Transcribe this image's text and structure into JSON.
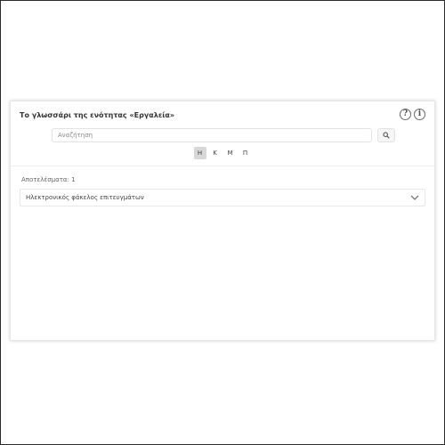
{
  "glossary": {
    "title": "Το γλωσσάρι της ενότητας «Εργαλεία»",
    "help_icon": "question-circle-icon",
    "info_icon": "info-circle-icon",
    "search": {
      "placeholder": "Αναζήτηση",
      "value": "",
      "button_icon": "search-icon"
    },
    "letters": [
      {
        "label": "Η",
        "active": true
      },
      {
        "label": "Κ",
        "active": false
      },
      {
        "label": "Μ",
        "active": false
      },
      {
        "label": "Π",
        "active": false
      }
    ],
    "results_label": "Αποτελέσματα: 1",
    "entries": [
      {
        "label": "Ηλεκτρονικός φάκελος επιτευγμάτων",
        "expand_icon": "chevron-down-icon"
      }
    ]
  }
}
